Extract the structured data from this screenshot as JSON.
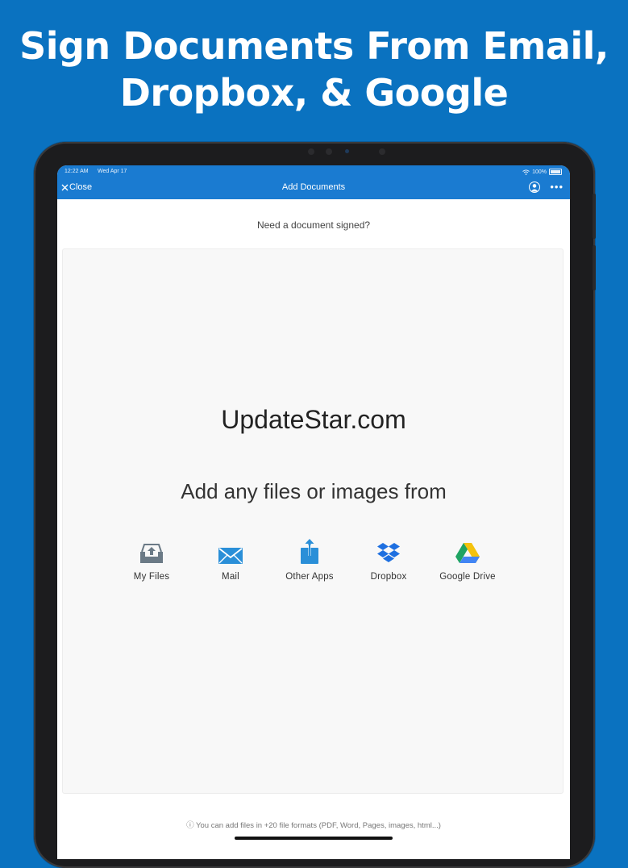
{
  "headline": {
    "line1": "Sign Documents From Email,",
    "line2": "Dropbox, & Google"
  },
  "status_bar": {
    "time": "12:22 AM",
    "date": "Wed Apr 17",
    "battery": "100%"
  },
  "nav": {
    "close_label": "Close",
    "title": "Add Documents"
  },
  "prompt": "Need a document signed?",
  "watermark": "UpdateStar.com",
  "add_text": "Add any files or images from",
  "sources": [
    {
      "label": "My Files",
      "icon": "tray-upload-icon"
    },
    {
      "label": "Mail",
      "icon": "mail-icon"
    },
    {
      "label": "Other Apps",
      "icon": "share-icon"
    },
    {
      "label": "Dropbox",
      "icon": "dropbox-icon"
    },
    {
      "label": "Google Drive",
      "icon": "google-drive-icon"
    }
  ],
  "footnote": "You can add files in +20 file formats (PDF, Word, Pages, images, html...)",
  "colors": {
    "background": "#0a72c0",
    "nav_bar": "#1a7bd1",
    "icon_blue": "#2a8fd8",
    "my_files_gray": "#6b7a86"
  }
}
